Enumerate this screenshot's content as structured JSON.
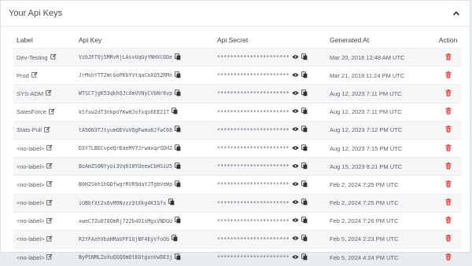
{
  "panel": {
    "title": "Your Api Keys"
  },
  "columns": {
    "label": "Label",
    "api_key": "Api Key",
    "api_secret": "Api Secret",
    "generated_at": "Generated At",
    "action": "Action"
  },
  "rows": [
    {
      "label": "Dev-Testing",
      "api_key": "VzbJFT0j5MRvRjLAsvUqGyYNHXC6De",
      "api_secret": "**********************",
      "generated_at": "Mar 20, 2018 12:48 AM UTC"
    },
    {
      "label": "Prod",
      "api_key": "JrMsbYTT2WcGoPKbYVtqaCoXQ52RMn",
      "api_secret": "**********************",
      "generated_at": "Mar 21, 2019 11:24 PM UTC"
    },
    {
      "label": "SYS-ADM",
      "api_key": "WTSCTjgK53qkhQJcXmVVNyCVbNr8vp",
      "api_secret": "**********************",
      "generated_at": "Aug 12, 2023 7:11 PM UTC"
    },
    {
      "label": "SalesForce",
      "api_key": "kSfxw2dT3nkpoYKwHJsfxqs6EE21T",
      "api_secret": "**********************",
      "generated_at": "Aug 12, 2023 7:11 PM UTC"
    },
    {
      "label": "Stats-Pull",
      "api_key": "tA5ON3TJtyumGEVuVQgFwmu6JfwC68",
      "api_secret": "**********************",
      "generated_at": "Aug 12, 2023 7:12 PM UTC"
    },
    {
      "label": "<no-label>",
      "api_key": "D3Y7LBECvpeQrEaeMV7JrwmxqrSDH2",
      "api_secret": "**********************",
      "generated_at": "Aug 12, 2023 7:15 PM UTC"
    },
    {
      "label": "<no-label>",
      "api_key": "BoAmZS0NYyoi3Vq018YUeewCbHSiU5",
      "api_secret": "**********************",
      "generated_at": "Aug 15, 2023 8:21 PM UTC"
    },
    {
      "label": "<no-label>",
      "api_key": "B0H2Skh1hGDfwgrRVR9daYJTgbVeWp",
      "api_secret": "**********************",
      "generated_at": "Feb 2, 2024 7:25 PM UTC"
    },
    {
      "label": "<no-label>",
      "api_key": "iUBbfXt2s6vM9Nzzz3tXkg4KIGfs",
      "api_secret": "**********************",
      "generated_at": "Feb 2, 2024 7:25 PM UTC"
    },
    {
      "label": "<no-label>",
      "api_key": "xweC7Zu078OmRj722b4O1sMgsVNDGU",
      "api_secret": "**********************",
      "generated_at": "Feb 2, 2024 7:26 PM UTC"
    },
    {
      "label": "<no-label>",
      "api_key": "R2YFAehVbaHMaUFF1QjBF4EyVfoOb",
      "api_secret": "**********************",
      "generated_at": "Feb 5, 2024 2:23 PM UTC"
    },
    {
      "label": "<no-label>",
      "api_key": "ByPSNMLZoXuQGQOmDtEGtgxnVwDE3j",
      "api_secret": "**********************",
      "generated_at": "Feb 5, 2024 4:24 PM UTC"
    }
  ],
  "icons": {
    "edit": "edit-icon",
    "copy": "copy-icon",
    "eye": "eye-icon",
    "trash": "trash-icon",
    "collapse": "chevron-up-icon"
  },
  "colors": {
    "delete": "#e53935",
    "text": "#5a5f66"
  }
}
